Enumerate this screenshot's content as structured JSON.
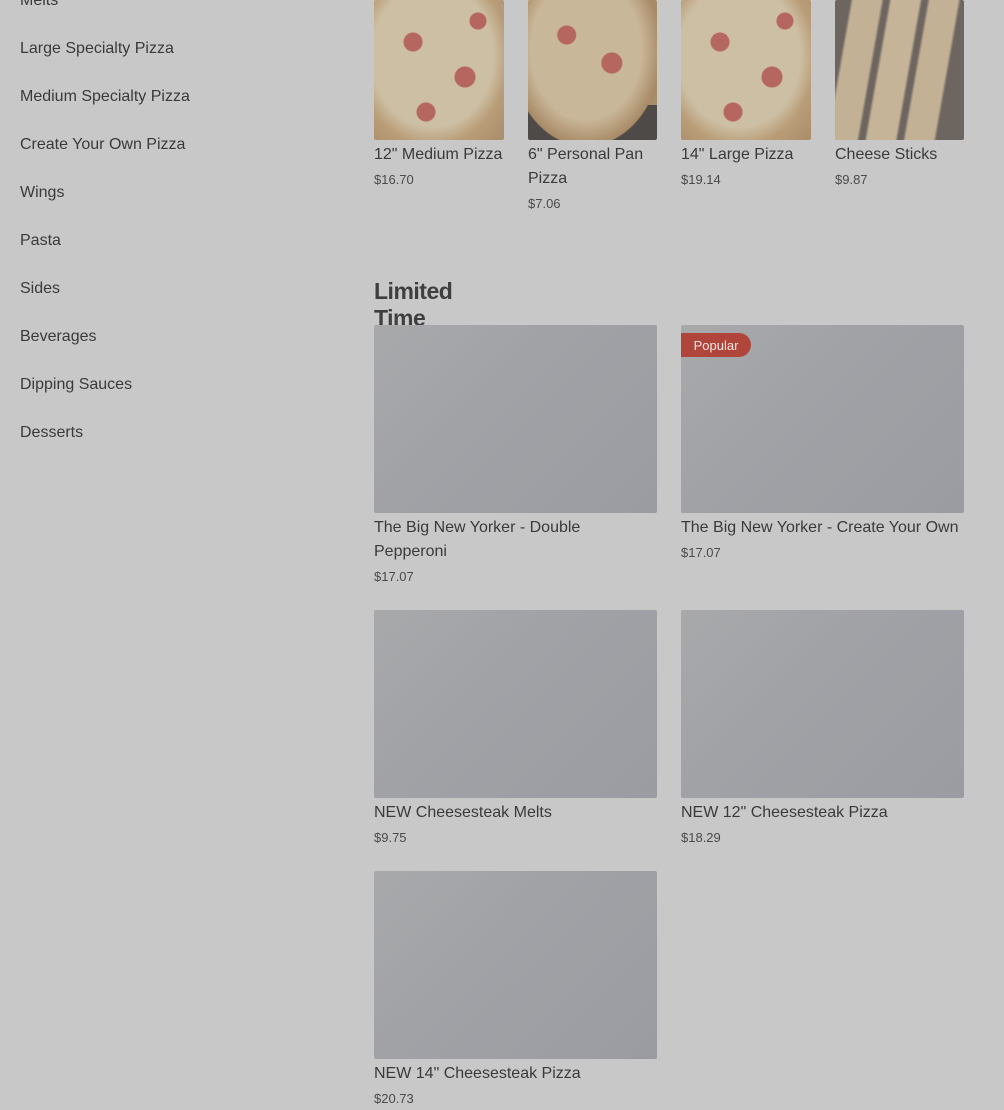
{
  "sidebar": {
    "items": [
      {
        "label": "Melts"
      },
      {
        "label": "Large Specialty Pizza"
      },
      {
        "label": "Medium Specialty Pizza"
      },
      {
        "label": "Create Your Own Pizza"
      },
      {
        "label": "Wings"
      },
      {
        "label": "Pasta"
      },
      {
        "label": "Sides"
      },
      {
        "label": "Beverages"
      },
      {
        "label": "Dipping Sauces"
      },
      {
        "label": "Desserts"
      }
    ]
  },
  "top_items": [
    {
      "name": "12\" Medium Pizza",
      "price": "$16.70"
    },
    {
      "name": "6\" Personal Pan Pizza",
      "price": "$7.06"
    },
    {
      "name": "14\" Large Pizza",
      "price": "$19.14"
    },
    {
      "name": "Cheese Sticks",
      "price": "$9.87"
    }
  ],
  "limited": {
    "title": "Limited Time Items",
    "badge": "Popular",
    "items": [
      {
        "name": "The Big New Yorker - Double Pepperoni",
        "price": "$17.07"
      },
      {
        "name": "The Big New Yorker - Create Your Own",
        "price": "$17.07"
      },
      {
        "name": "NEW Cheesesteak Melts",
        "price": "$9.75"
      },
      {
        "name": "NEW 12\" Cheesesteak Pizza",
        "price": "$18.29"
      },
      {
        "name": "NEW 14\" Cheesesteak Pizza",
        "price": "$20.73"
      }
    ]
  }
}
